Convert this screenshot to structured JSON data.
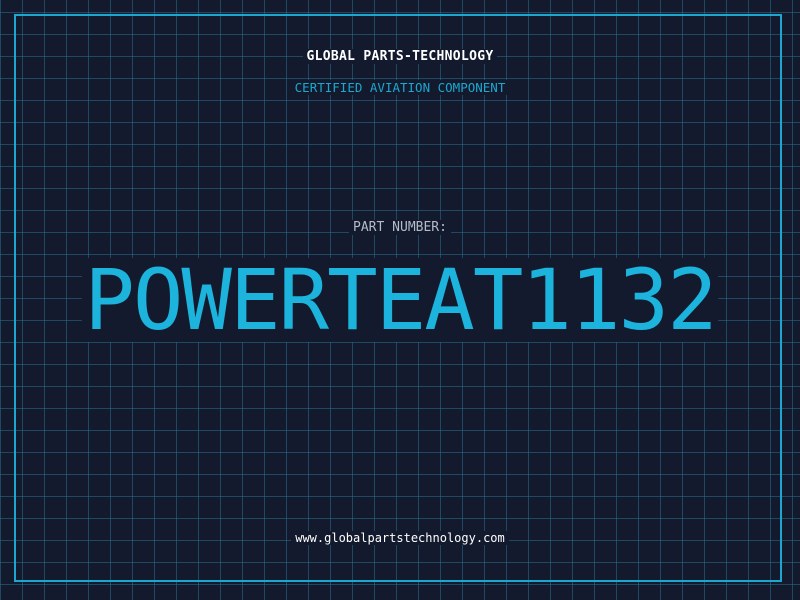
{
  "header": {
    "company": "GLOBAL PARTS-TECHNOLOGY",
    "subtitle": "CERTIFIED AVIATION COMPONENT"
  },
  "part": {
    "label": "PART NUMBER:",
    "number": "POWERTEAT1132"
  },
  "footer": {
    "website": "www.globalpartstechnology.com"
  },
  "colors": {
    "background": "#131a2e",
    "grid": "#286e8c",
    "accent": "#1cb3dc",
    "frame": "#1ba7cf",
    "label": "#b4bcc8",
    "text": "#ffffff"
  }
}
